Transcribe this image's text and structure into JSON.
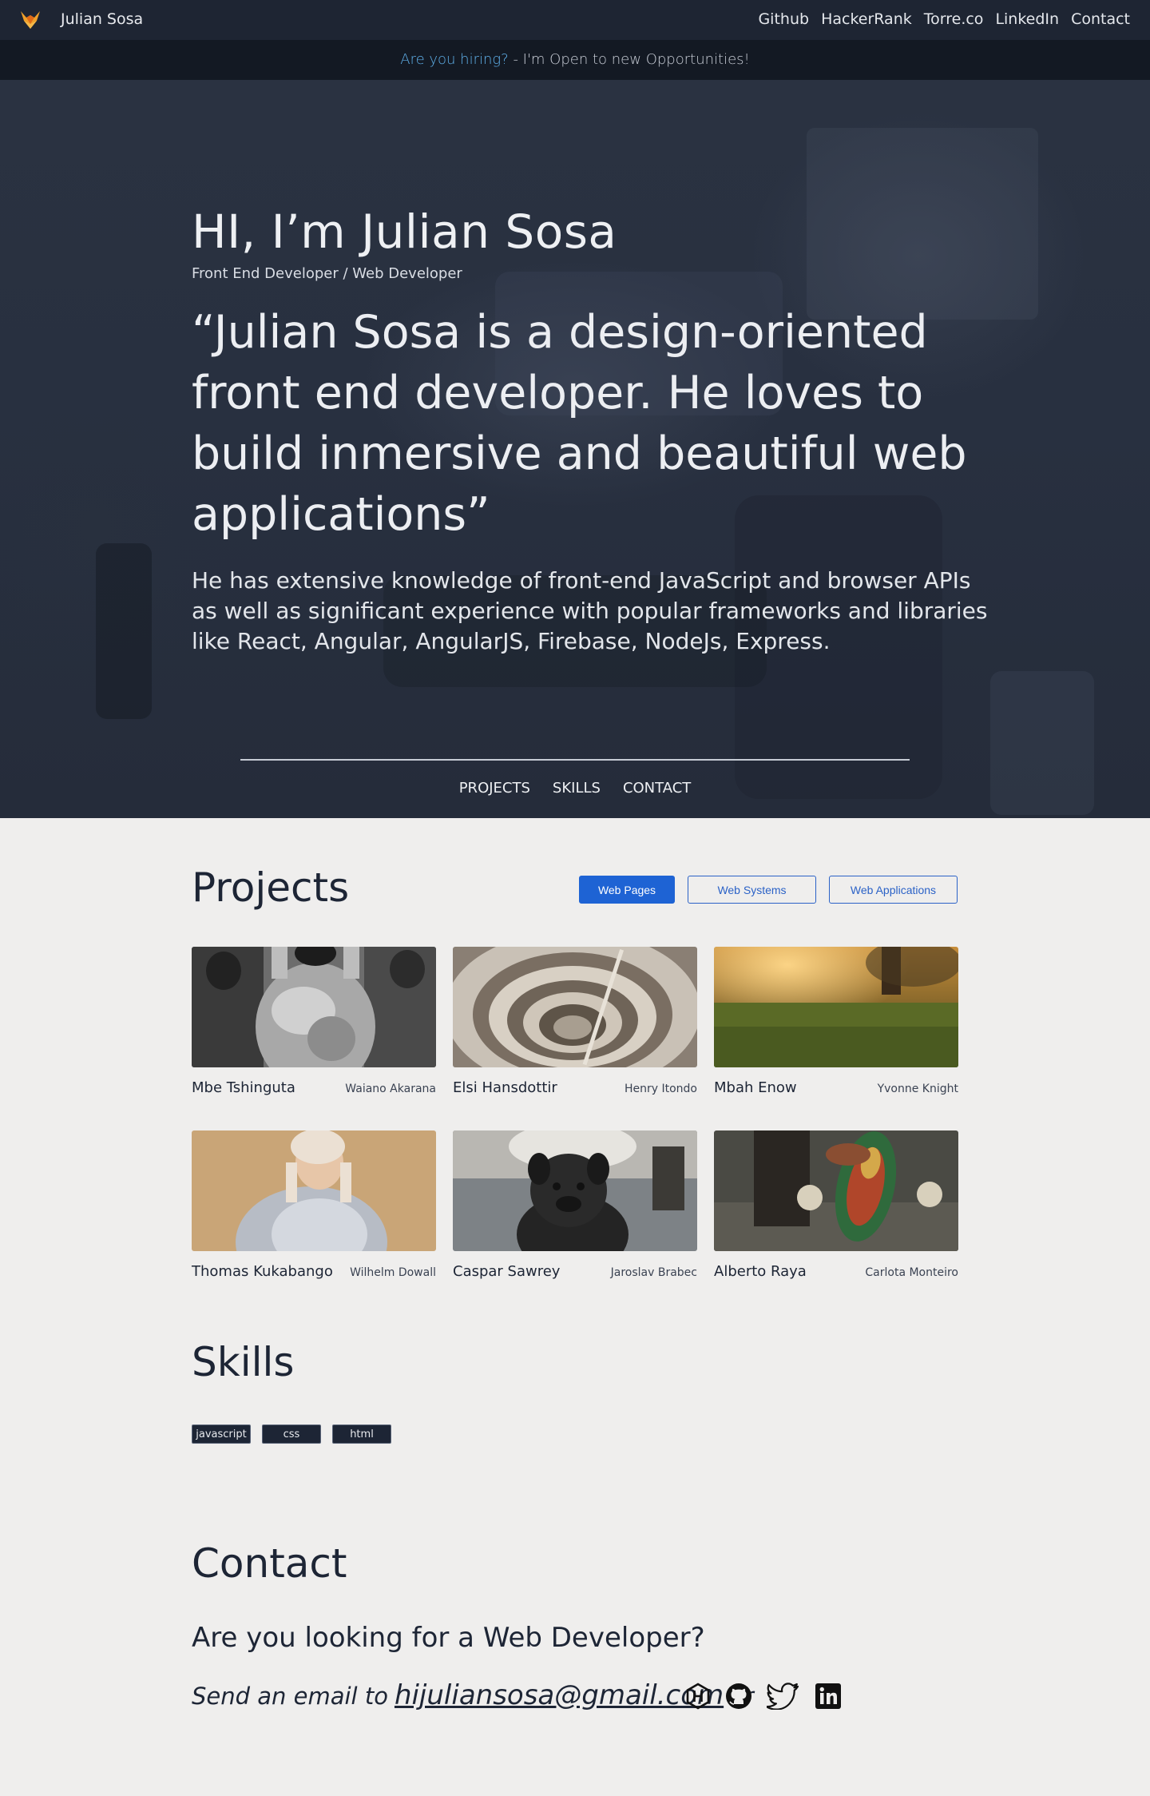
{
  "navbar": {
    "brand": "Julian Sosa",
    "links": [
      "Github",
      "HackerRank",
      "Torre.co",
      "LinkedIn",
      "Contact"
    ]
  },
  "hiring": {
    "question": "Are you hiring?",
    "message": " - I'm Open to new Opportunities!"
  },
  "hero": {
    "title": "HI, I’m Julian Sosa",
    "role": "Front End Developer / Web Developer",
    "quote": "“Julian Sosa is a design-oriented front end developer. He loves to build inmersive and beautiful web applications”",
    "bio": "He has extensive knowledge of front-end JavaScript and browser APIs as well as significant experience with popular frameworks and libraries like React, Angular, AngularJS, Firebase, NodeJs, Express.",
    "nav": [
      "PROJECTS",
      "SKILLS",
      "CONTACT"
    ]
  },
  "projects": {
    "title": "Projects",
    "filters": [
      "Web Pages",
      "Web Systems",
      "Web Applications"
    ],
    "active_filter": "Web Pages",
    "items": [
      {
        "name": "Mbe Tshinguta",
        "author": "Waiano Akarana",
        "image": "crowd-silver-jacket"
      },
      {
        "name": "Elsi Hansdottir",
        "author": "Henry Itondo",
        "image": "spiral-staircase"
      },
      {
        "name": "Mbah Enow",
        "author": "Yvonne Knight",
        "image": "grass-field-sunset"
      },
      {
        "name": "Thomas Kukabango",
        "author": "Wilhelm Dowall",
        "image": "woman-grey-jacket"
      },
      {
        "name": "Caspar Sawrey",
        "author": "Jaroslav Brabec",
        "image": "black-pug"
      },
      {
        "name": "Alberto Raya",
        "author": "Carlota Monteiro",
        "image": "skateboard"
      }
    ]
  },
  "skills": {
    "title": "Skills",
    "tags": [
      "javascript",
      "css",
      "html"
    ]
  },
  "contact": {
    "title": "Contact",
    "question": "Are you looking for a Web Developer?",
    "prefix": "Send an email to",
    "email": "hijuliansosa@gmail.com",
    "suffix": "or",
    "socials": [
      "hackerrank-icon",
      "github-icon",
      "twitter-icon",
      "linkedin-icon"
    ]
  },
  "colors": {
    "nav_bg": "#1e2533",
    "hiring_bg": "#131923",
    "accent": "#1e63d4",
    "page_bg": "#efeeed",
    "text_dark": "#1d2535",
    "hiring_link": "#5fb0ea"
  }
}
